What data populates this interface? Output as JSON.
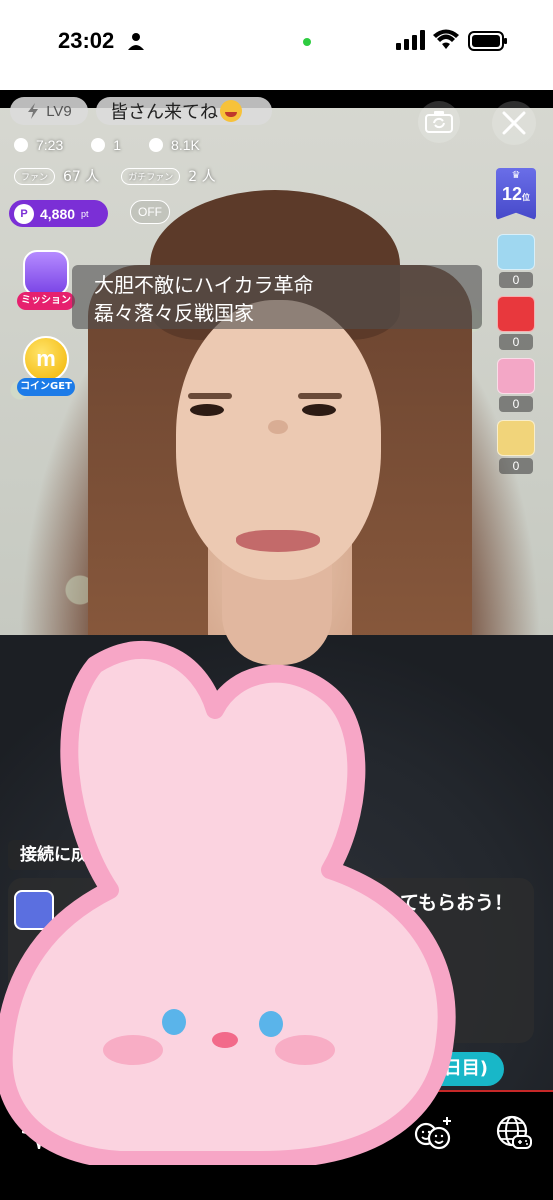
{
  "status_bar": {
    "time": "23:02"
  },
  "header": {
    "level": "LV9",
    "greeting": "皆さん来てね"
  },
  "stats": {
    "duration": "7:23",
    "comments": "1",
    "views": "8.1K"
  },
  "fans": {
    "fan_tag": "ファン",
    "fan_count": "67 人",
    "gachi_tag": "ガチファン",
    "gachi_count": "2 人"
  },
  "points": {
    "value": "4,880",
    "unit": "pt",
    "off_label": "OFF"
  },
  "side_buttons": {
    "mission_label": "ミッション",
    "coin_label": "コインGET",
    "coin_glyph": "m"
  },
  "song": {
    "line1": "大胆不敵にハイカラ革命",
    "line2": "磊々落々反戦国家"
  },
  "rank": {
    "number": "12",
    "suffix": "位"
  },
  "gifts": [
    {
      "icon": "car-gift-icon",
      "count": "0",
      "color": "#9fd7f0"
    },
    {
      "icon": "red-box-gift-icon",
      "count": "0",
      "color": "#e8383d"
    },
    {
      "icon": "peach-gift-icon",
      "count": "0",
      "color": "#f3a7c6"
    },
    {
      "icon": "animals-gift-icon",
      "count": "0",
      "color": "#f1d47a"
    }
  ],
  "lower": {
    "connect_label": "接続に成",
    "banner_text": "てもらおう！",
    "day_pill": "日目)"
  },
  "colors": {
    "points_bg": "#7b2fd6",
    "mission_label_bg": "#e6206e",
    "coin_label_bg": "#1c7be8",
    "rank_bg": "#4649c9",
    "day_pill_bg": "#18b7c8",
    "bunny_pink": "#fbd3e0",
    "bunny_outline": "#f7a6c6"
  }
}
